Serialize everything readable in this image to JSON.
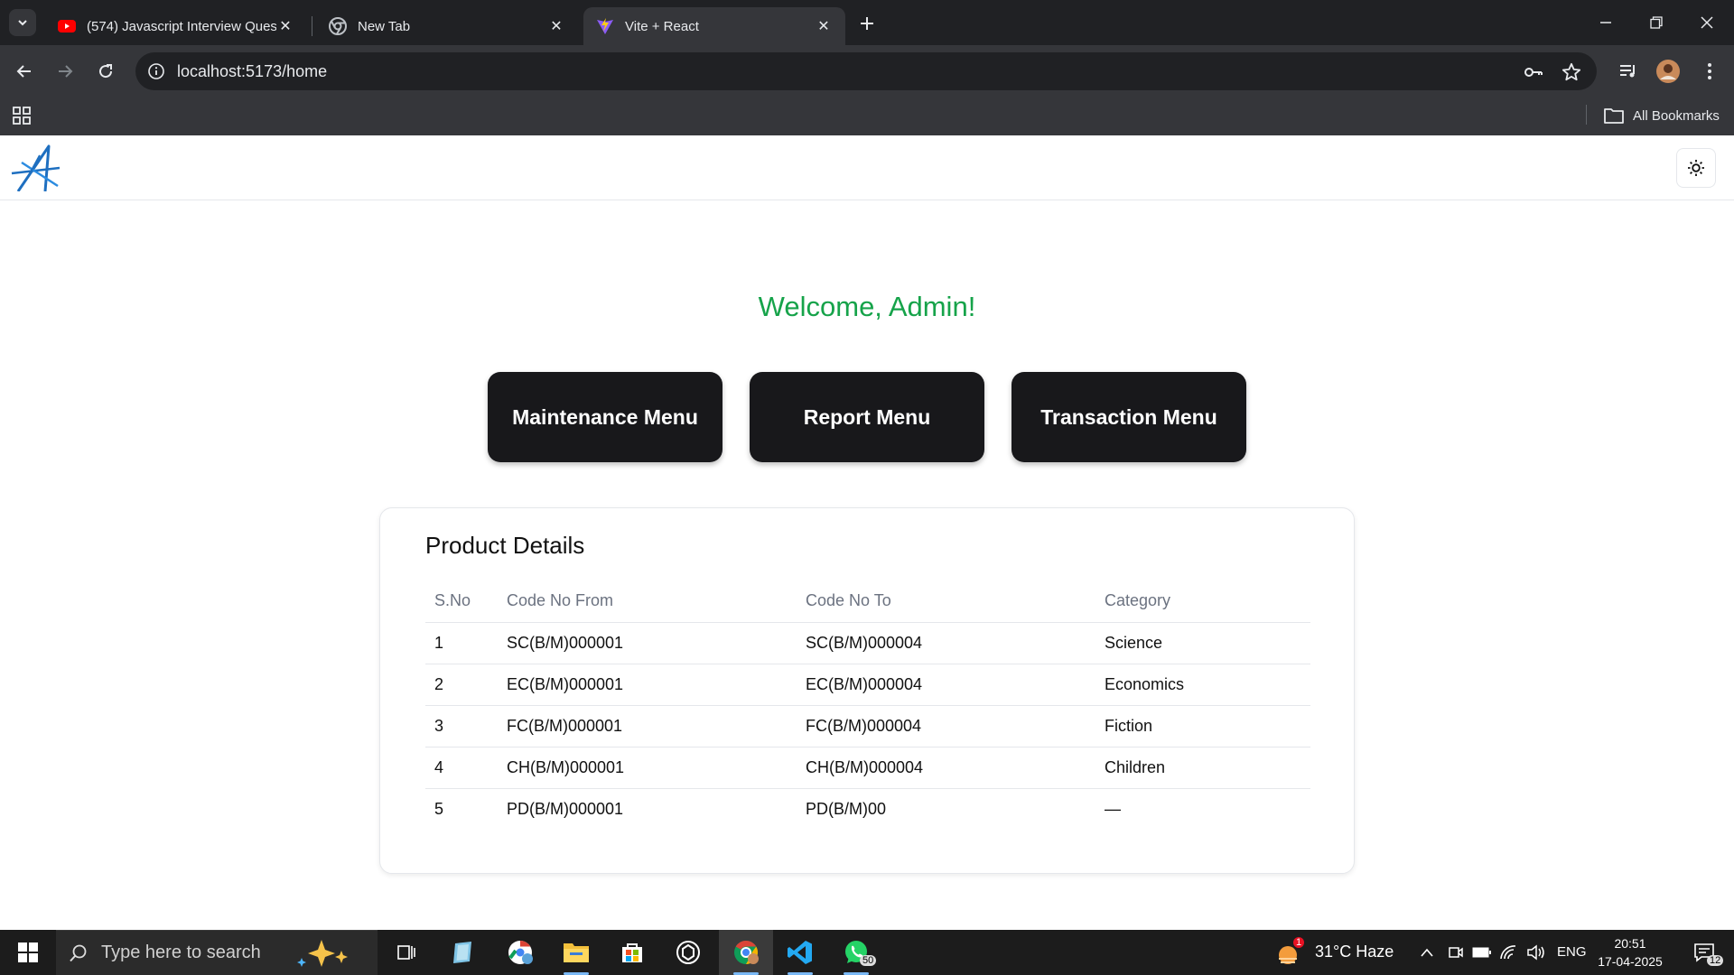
{
  "browser": {
    "tabs": [
      {
        "title": "(574) Javascript Interview Questions",
        "favicon": "youtube-icon"
      },
      {
        "title": "New Tab",
        "favicon": "chrome-icon"
      },
      {
        "title": "Vite + React",
        "favicon": "vite-icon"
      }
    ],
    "address": "localhost:5173/home",
    "bookmarks_label": "All Bookmarks"
  },
  "main": {
    "welcome": "Welcome, Admin!",
    "menus": [
      "Maintenance Menu",
      "Report Menu",
      "Transaction Menu"
    ],
    "product_card": {
      "title": "Product Details",
      "columns": [
        "S.No",
        "Code No From",
        "Code No To",
        "Category"
      ],
      "rows": [
        [
          "1",
          "SC(B/M)000001",
          "SC(B/M)000004",
          "Science"
        ],
        [
          "2",
          "EC(B/M)000001",
          "EC(B/M)000004",
          "Economics"
        ],
        [
          "3",
          "FC(B/M)000001",
          "FC(B/M)000004",
          "Fiction"
        ],
        [
          "4",
          "CH(B/M)000001",
          "CH(B/M)000004",
          "Children"
        ],
        [
          "5",
          "PD(B/M)000001",
          "PD(B/M)00",
          "—"
        ]
      ]
    }
  },
  "taskbar": {
    "search_placeholder": "Type here to search",
    "weather": "31°C  Haze",
    "weather_badge": "1",
    "language": "ENG",
    "time": "20:51",
    "date": "17-04-2025",
    "whatsapp_badge": "50",
    "notifications_badge": "12"
  },
  "colors": {
    "accent_green": "#16a34a",
    "menu_button_bg": "#18181b",
    "chrome_dark": "#202124",
    "chrome_toolbar": "#35363a"
  }
}
